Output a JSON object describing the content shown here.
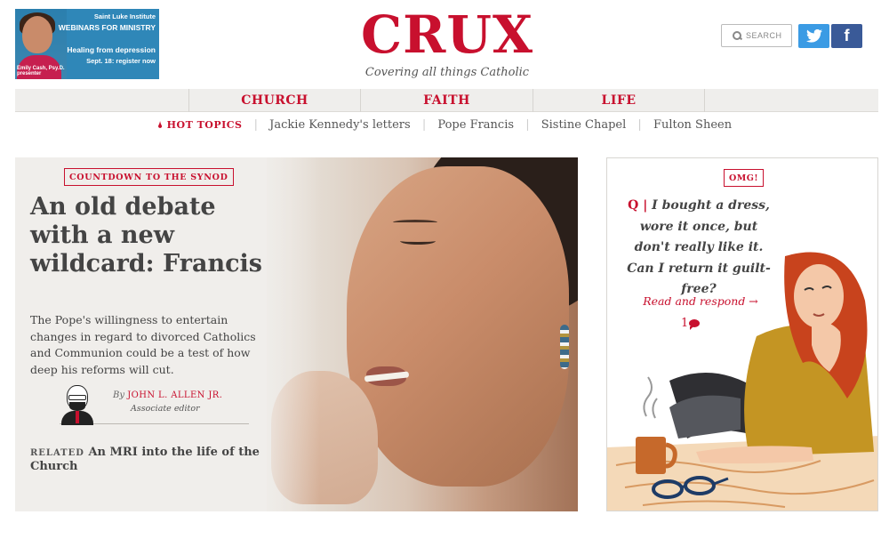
{
  "ad": {
    "line1": "Saint Luke Institute",
    "line2": "WEBINARS FOR MINISTRY",
    "line3": "Healing from depression",
    "line4": "Sept. 18: register now",
    "presenter": "Emily Cash, Psy.D.",
    "presenter_role": "presenter",
    "accent": "#2f87b8"
  },
  "brand": {
    "logo": "CRUX",
    "tagline": "Covering all things Catholic",
    "color": "#c8102e"
  },
  "header": {
    "search_label": "SEARCH",
    "twitter_glyph": "🐦",
    "facebook_glyph": "f"
  },
  "nav": {
    "items": [
      {
        "label": "CHURCH"
      },
      {
        "label": "FAITH"
      },
      {
        "label": "LIFE"
      }
    ]
  },
  "topics": {
    "label": "HOT TOPICS",
    "items": [
      "Jackie Kennedy's letters",
      "Pope Francis",
      "Sistine Chapel",
      "Fulton Sheen"
    ]
  },
  "feature": {
    "kicker": "COUNTDOWN TO THE SYNOD",
    "headline": "An old debate with a new wildcard: Francis",
    "dek": "The Pope's willingness to entertain changes in regard to divorced Catholics and Communion could be a test of how deep his reforms will cut.",
    "by": "By",
    "author": "JOHN L. ALLEN JR.",
    "author_role": "Associate editor",
    "related_label": "RELATED",
    "related_text": "An MRI into the life of the Church"
  },
  "omg": {
    "badge": "OMG!",
    "q_prefix": "Q |",
    "question": "I bought a dress, wore it once, but don't really like it. Can I return it guilt-free?",
    "cta": "Read and respond →",
    "comment_count": "1"
  }
}
